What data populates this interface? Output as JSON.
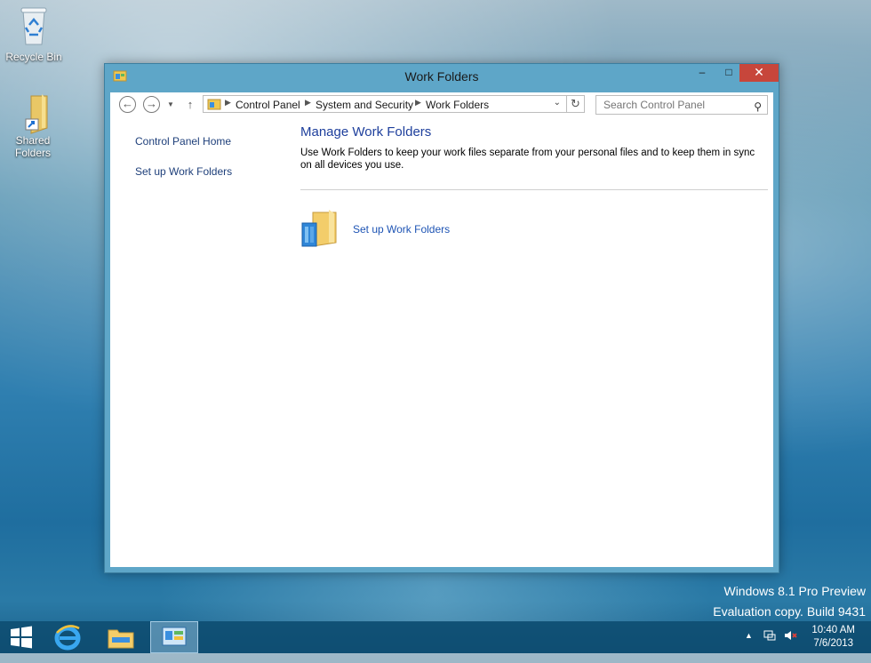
{
  "desktop": {
    "icons": [
      {
        "label": "Recycle Bin"
      },
      {
        "label": "Shared\nFolders"
      }
    ],
    "watermark": {
      "line1": "Windows 8.1 Pro Preview",
      "line2": "Evaluation copy. Build 9431"
    }
  },
  "window": {
    "title": "Work Folders",
    "controls": {
      "minimize": "–",
      "maximize": "□",
      "close": "✕"
    }
  },
  "address": {
    "breadcrumbs": [
      "Control Panel",
      "System and Security",
      "Work Folders"
    ],
    "search_placeholder": "Search Control Panel"
  },
  "sidebar": {
    "items": [
      {
        "label": "Control Panel Home"
      },
      {
        "label": "Set up Work Folders"
      }
    ]
  },
  "main": {
    "heading": "Manage Work Folders",
    "description": "Use Work Folders to keep your work files separate from your personal files and to keep them in sync on all devices you use.",
    "task_link": "Set up Work Folders"
  },
  "taskbar": {
    "clock_time": "10:40 AM",
    "clock_date": "7/6/2013"
  },
  "colors": {
    "link": "#1e54b4",
    "heading": "#1e3f9c",
    "close_button": "#c7463b",
    "window_frame": "#5ea6c8"
  }
}
